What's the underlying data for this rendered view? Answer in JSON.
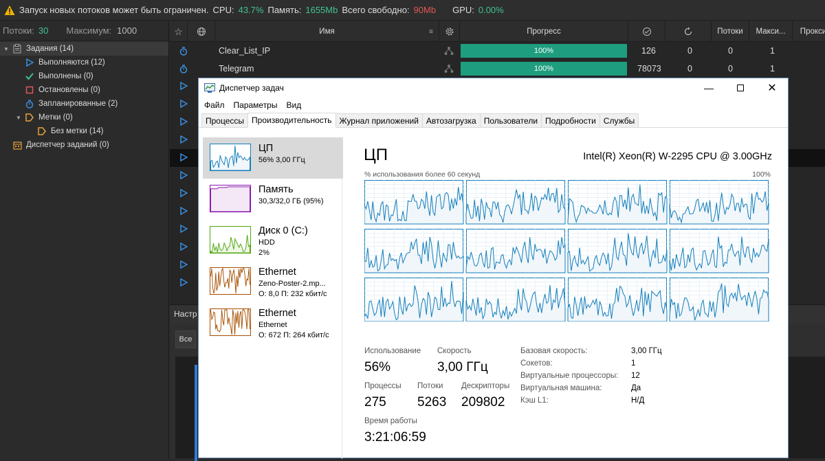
{
  "topbar": {
    "warning_text": "Запуск новых потоков может быть ограничен.",
    "cpu_label": "CPU:",
    "cpu_value": "43.7%",
    "mem_label": "Память:",
    "mem_value": "1655Mb",
    "free_label": "Всего свободно:",
    "free_value": "90Mb",
    "gpu_label": "GPU:",
    "gpu_value": "0.00%"
  },
  "left": {
    "threads_label": "Потоки:",
    "threads_value": "30",
    "max_label": "Максимум:",
    "max_value": "1000",
    "tree": [
      {
        "label": "Задания (14)",
        "icon": "clipboard-icon"
      },
      {
        "label": "Выполняются (12)",
        "icon": "play-icon"
      },
      {
        "label": "Выполнены (0)",
        "icon": "check-icon"
      },
      {
        "label": "Остановлены (0)",
        "icon": "stop-icon"
      },
      {
        "label": "Запланированные (2)",
        "icon": "timer-icon"
      },
      {
        "label": "Метки (0)",
        "icon": "tag-icon"
      },
      {
        "label": "Без метки (14)",
        "icon": "tag-icon"
      },
      {
        "label": "Диспетчер заданий (0)",
        "icon": "calendar-icon"
      }
    ]
  },
  "table": {
    "headers": {
      "name": "Имя",
      "progress": "Прогресс",
      "threads": "Потоки",
      "max": "Макси...",
      "proxy": "Прокси"
    },
    "rows": [
      {
        "name": "Clear_List_IP",
        "progress": "100%",
        "done": "126",
        "failed": "0",
        "threads": "0",
        "max": "1"
      },
      {
        "name": "Telegram",
        "progress": "100%",
        "done": "78073",
        "failed": "0",
        "threads": "0",
        "max": "1"
      }
    ],
    "bottom_tab": "Настр",
    "bottom_button": "Все"
  },
  "taskmgr": {
    "title": "Диспетчер задач",
    "menu": [
      "Файл",
      "Параметры",
      "Вид"
    ],
    "tabs": [
      "Процессы",
      "Производительность",
      "Журнал приложений",
      "Автозагрузка",
      "Пользователи",
      "Подробности",
      "Службы"
    ],
    "side": [
      {
        "name": "ЦП",
        "line1": "56% 3,00 ГГц",
        "line2": ""
      },
      {
        "name": "Память",
        "line1": "30,3/32,0 ГБ (95%)",
        "line2": ""
      },
      {
        "name": "Диск 0 (C:)",
        "line1": "HDD",
        "line2": "2%"
      },
      {
        "name": "Ethernet",
        "line1": "Zeno-Poster-2.mp...",
        "line2": "О: 8,0  П: 232 кбит/с"
      },
      {
        "name": "Ethernet",
        "line1": "Ethernet",
        "line2": "О: 672  П: 264 кбит/с"
      }
    ],
    "cpu": {
      "title": "ЦП",
      "model": "Intel(R) Xeon(R) W-2295 CPU @ 3.00GHz",
      "usage_label": "% использования более 60 секунд",
      "usage_max": "100%",
      "stats": {
        "usage_label": "Использование",
        "usage": "56%",
        "speed_label": "Скорость",
        "speed": "3,00 ГГц",
        "proc_label": "Процессы",
        "proc": "275",
        "threads_label": "Потоки",
        "threads": "5263",
        "handles_label": "Дескрипторы",
        "handles": "209802",
        "uptime_label": "Время работы",
        "uptime": "3:21:06:59"
      },
      "specs": [
        {
          "k": "Базовая скорость:",
          "v": "3,00 ГГц"
        },
        {
          "k": "Сокетов:",
          "v": "1"
        },
        {
          "k": "Виртуальные процессоры:",
          "v": "12"
        },
        {
          "k": "Виртуальная машина:",
          "v": "Да"
        },
        {
          "k": "Кэш L1:",
          "v": "Н/Д"
        }
      ]
    }
  },
  "colors": {
    "green": "#3fc38f",
    "red": "#e05555",
    "progress": "#1e9e7f",
    "cpu_line": "#117dbb",
    "mem_line": "#8b12ae",
    "disk_line": "#4da60c",
    "net_line": "#a74f01"
  }
}
